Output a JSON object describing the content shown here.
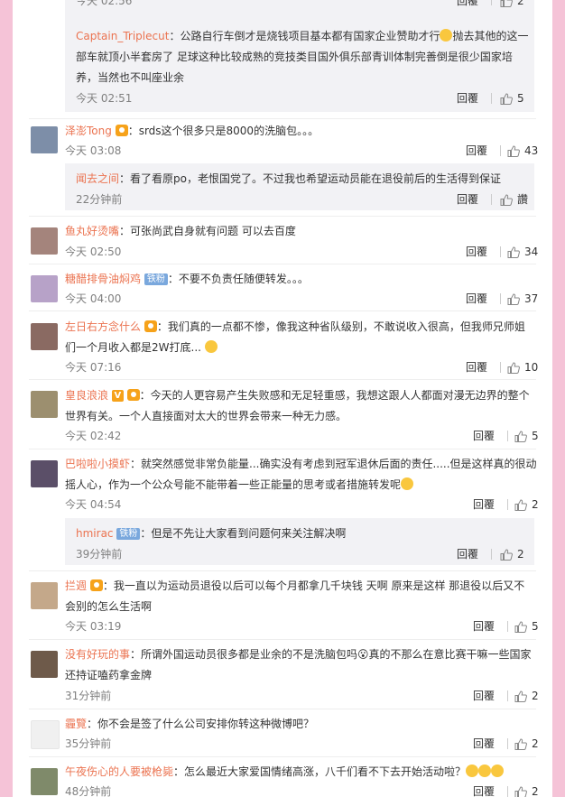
{
  "colors": {
    "page_bg": "#f5c3d7",
    "username": "#eb7350",
    "reply_bg": "#f2f2f5"
  },
  "actions": {
    "reply": "回覆",
    "like_icon": "thumbs-up-icon"
  },
  "top_partial": {
    "time": "今天 02:56",
    "likes": "2"
  },
  "reply_1": {
    "user": "Captain_Triplecut",
    "sep": "：",
    "lines": [
      "公路自行车倒才是烧钱项目基本都有国家企业赞助才行",
      "部车就顶小半套房了 足球这种比较成熟的竞技类目国外俱乐部青训体制完善倒是很少国家培",
      "养，当然也不叫座业余"
    ],
    "line1_tail": "抛去其他的这一",
    "time": "今天 02:51",
    "likes": "5"
  },
  "comments": [
    {
      "user": "泽澎Tong",
      "text": "：srds这个很多只是8000的洗脑包。。。",
      "time": "今天 03:08",
      "likes": "43"
    },
    {
      "user": "鱼丸好烫嘴",
      "text": "：可张尚武自身就有问题 可以去百度",
      "time": "今天 02:50",
      "likes": "34"
    },
    {
      "user": "糖醋排骨油焖鸡",
      "badge": "铁粉",
      "text": "：不要不负责任随便转发。。。",
      "time": "今天 04:00",
      "likes": "37"
    },
    {
      "user": "左日右方念什么",
      "lines": [
        "：我们真的一点都不惨，像我这种省队级别，不敢说收入很高，但我师兄师姐",
        "们一个月收入都是2W打底..."
      ],
      "time": "今天 07:16",
      "likes": "10"
    },
    {
      "user": "皇良浪浪",
      "vbadge": "V",
      "lines": [
        "：今天的人更容易产生失败感和无足轻重感，我想这跟人人都面对漫无边界的整个",
        "世界有关。一个人直接面对太大的世界会带来一种无力感。"
      ],
      "time": "今天 02:42",
      "likes": "5"
    },
    {
      "user": "巴啦啦小摸虾",
      "lines": [
        "：就突然感觉非常负能量...确实没有考虑到冠军退休后面的责任.....但是这样真的很动",
        "摇人心，作为一个公众号能不能带着一些正能量的思考或者措施转发呢"
      ],
      "time": "今天 04:54",
      "likes": "2"
    },
    {
      "user": "拦週",
      "lines": [
        "：我一直以为运动员退役以后可以每个月都拿几千块钱 天啊 原来是这样 那退役以后又不",
        "会别的怎么生活啊"
      ],
      "time": "今天 03:19",
      "likes": "5"
    },
    {
      "user": "没有好玩的事",
      "lines": [
        "：所谓外国运动员很多都是业余的不是洗脑包吗😮真的不那么在意比赛干嘛一些国家",
        "还持证嗑药拿金牌"
      ],
      "time": "31分钟前",
      "likes": "2"
    },
    {
      "user": "霾覽",
      "text": "：你不会是签了什么公司安排你转这种微博吧？",
      "time": "35分钟前",
      "likes": "2"
    },
    {
      "user": "午夜伤心的人要被枪毙",
      "text": "：怎么最近大家爱国情绪高涨，八千们看不下去开始活动啦？",
      "time": "48分钟前",
      "likes": "2"
    }
  ],
  "reply_2": {
    "user": "闻去之间",
    "text": "：看了看原po，老恨国党了。不过我也希望运动员能在退役前后的生活得到保证",
    "time": "22分钟前",
    "likes": "讚"
  },
  "reply_3": {
    "user": "hmirac",
    "badge": "铁粉",
    "text": "：但是不先让大家看到问题何来关注解决啊",
    "time": "39分钟前",
    "likes": "2"
  }
}
